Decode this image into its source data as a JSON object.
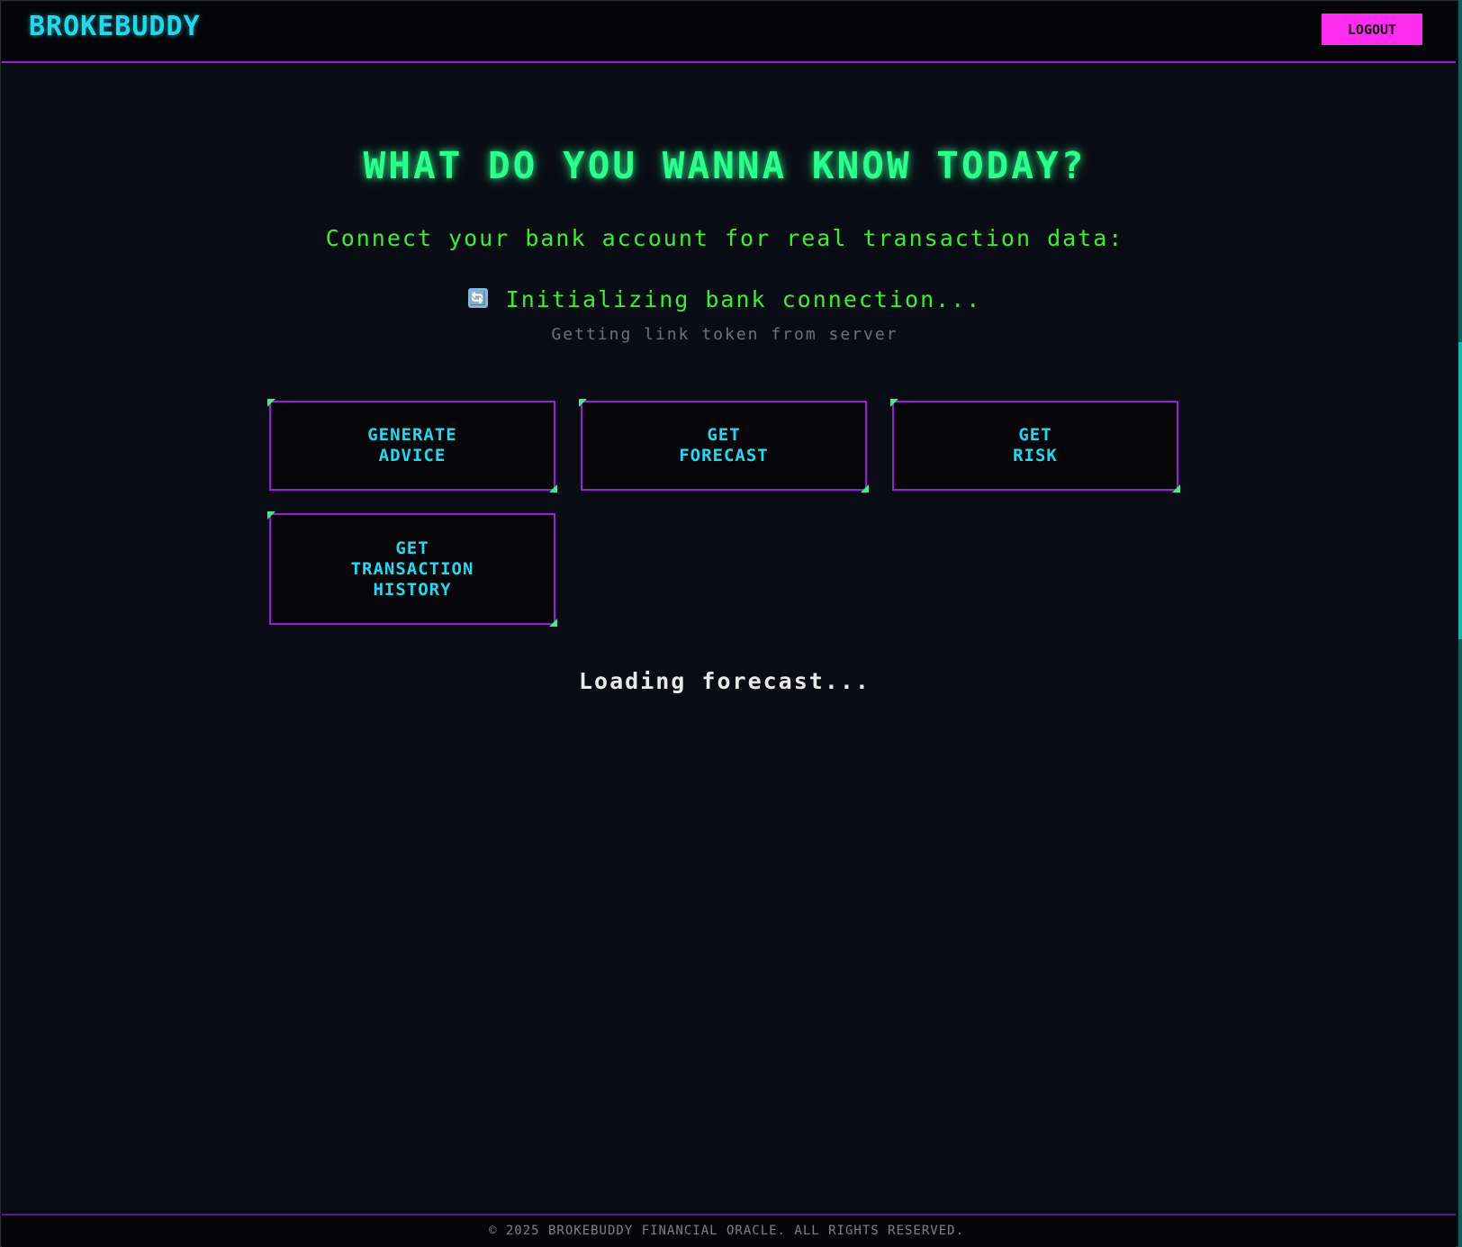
{
  "header": {
    "brand": "BROKEBUDDY",
    "logout_label": "LOGOUT"
  },
  "main": {
    "headline": "WHAT DO YOU WANNA KNOW TODAY?",
    "connect_prompt": "Connect your bank account for real transaction data:",
    "status": {
      "icon": "refresh-icon",
      "icon_glyph": "🔄",
      "text": "Initializing bank connection...",
      "subtext": "Getting link token from server"
    },
    "actions": [
      {
        "line1": "GENERATE",
        "line2": "ADVICE",
        "line3": ""
      },
      {
        "line1": "GET",
        "line2": "FORECAST",
        "line3": ""
      },
      {
        "line1": "GET",
        "line2": "RISK",
        "line3": ""
      },
      {
        "line1": "GET",
        "line2": "TRANSACTION",
        "line3": "HISTORY"
      }
    ],
    "loading_text": "Loading forecast..."
  },
  "footer": {
    "copyright": "© 2025 BROKEBUDDY FINANCIAL ORACLE. ALL RIGHTS RESERVED."
  },
  "colors": {
    "background": "#0a0c15",
    "brand": "#22d8ec",
    "logout_bg": "#ff2cf0",
    "headline": "#2bff8c",
    "accent_green": "#3bf02c",
    "button_border": "#9a1dd8",
    "button_text": "#25d8f2"
  }
}
